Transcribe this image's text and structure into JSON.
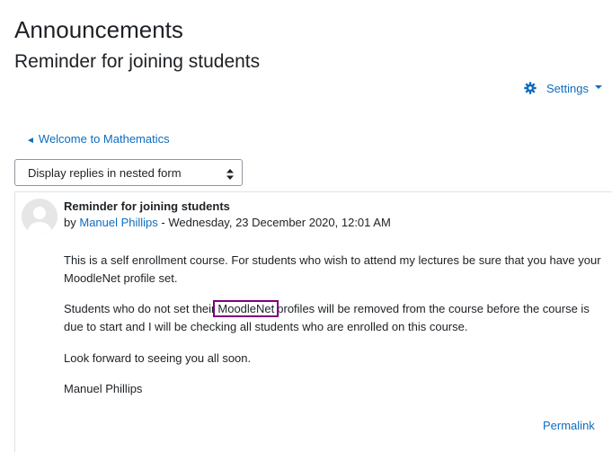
{
  "page": {
    "title": "Announcements",
    "discussion_title": "Reminder for joining students"
  },
  "settings_menu": {
    "label": "Settings",
    "icon": "gear-icon",
    "accent": "#0f6cbf"
  },
  "navigation": {
    "back_link": "Welcome to Mathematics",
    "back_arrow": "◄"
  },
  "display_mode": {
    "selected": "Display replies in nested form"
  },
  "post": {
    "subject": "Reminder for joining students",
    "by_prefix": "by",
    "author": "Manuel Phillips",
    "separator": "-",
    "date": "Wednesday, 23 December 2020, 12:01 AM",
    "paragraphs": {
      "p1": "This is a self enrollment course. For students who wish to attend my lectures be sure that you have your MoodleNet profile set.",
      "p2_before": "Students who do not set their",
      "p2_highlight": "MoodleNet",
      "p2_after": "profiles will be  removed from the course before the course is due to start and I will be checking all students who are enrolled on this course.",
      "p3": "Look forward to seeing you all soon.",
      "p4": "Manuel Phillips"
    },
    "highlight_color": "#800080",
    "permalink": "Permalink"
  }
}
